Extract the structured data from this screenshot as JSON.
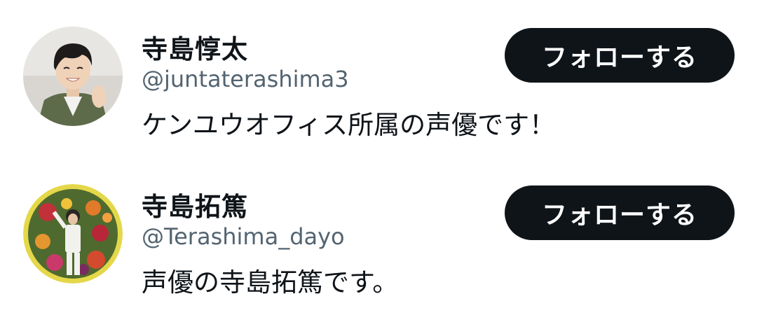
{
  "users": [
    {
      "name": "寺島惇太",
      "handle": "@juntaterashima3",
      "bio": "ケンユウオフィス所属の声優です！",
      "follow_label": "フォローする"
    },
    {
      "name": "寺島拓篤",
      "handle": "@Terashima_dayo",
      "bio": "声優の寺島拓篤です。",
      "follow_label": "フォローする"
    }
  ],
  "colors": {
    "button_bg": "#0f1419",
    "button_text": "#ffffff",
    "handle_text": "#536471",
    "avatar_ring": "#e4d84a"
  }
}
